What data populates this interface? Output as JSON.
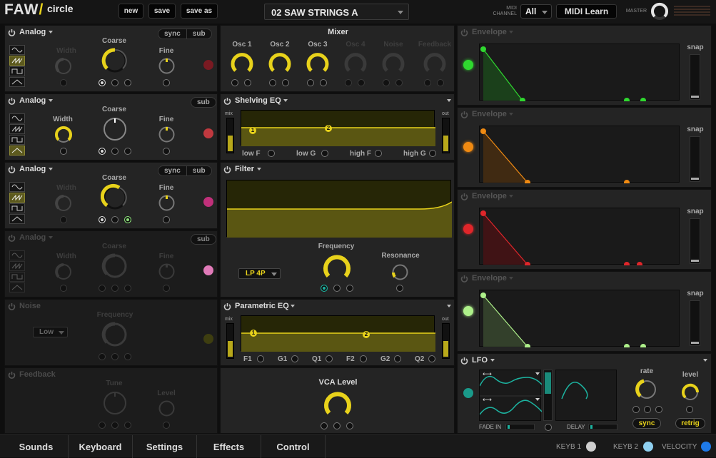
{
  "header": {
    "logo": "FAW",
    "logo_sub": "circle",
    "new_label": "new",
    "save_label": "save",
    "saveas_label": "save as",
    "preset_name": "02 SAW STRINGS A",
    "midi_channel_label_1": "MIDI",
    "midi_channel_label_2": "CHANNEL",
    "midi_channel_value": "All",
    "midi_learn_label": "MIDI Learn",
    "master_label": "MASTER"
  },
  "oscillators": [
    {
      "title": "Analog",
      "buttons": [
        "sync",
        "sub"
      ],
      "width_label": "Width",
      "coarse_label": "Coarse",
      "fine_label": "Fine",
      "led_color": "#7a1a22",
      "active": true
    },
    {
      "title": "Analog",
      "buttons": [
        "sub"
      ],
      "width_label": "Width",
      "coarse_label": "Coarse",
      "fine_label": "Fine",
      "led_color": "#c0393f",
      "active": true
    },
    {
      "title": "Analog",
      "buttons": [
        "sync",
        "sub"
      ],
      "width_label": "Width",
      "coarse_label": "Coarse",
      "fine_label": "Fine",
      "led_color": "#c0307a",
      "active": true
    },
    {
      "title": "Analog",
      "buttons": [
        "sub"
      ],
      "width_label": "Width",
      "coarse_label": "Coarse",
      "fine_label": "Fine",
      "led_color": "#e07ab8",
      "active": false
    }
  ],
  "noise": {
    "title": "Noise",
    "frequency_label": "Frequency",
    "type_value": "Low",
    "led_color": "#3e3e10"
  },
  "feedback": {
    "title": "Feedback",
    "tune_label": "Tune",
    "level_label": "Level"
  },
  "mixer": {
    "title": "Mixer",
    "channels": [
      "Osc 1",
      "Osc 2",
      "Osc 3",
      "Osc 4",
      "Noise",
      "Feedback"
    ]
  },
  "shelving_eq": {
    "title": "Shelving EQ",
    "mix_label": "mix",
    "out_label": "out",
    "params": [
      "low F",
      "low G",
      "high F",
      "high G"
    ],
    "nodes": [
      "1",
      "2"
    ]
  },
  "filter": {
    "title": "Filter",
    "type_value": "LP 4P",
    "frequency_label": "Frequency",
    "resonance_label": "Resonance"
  },
  "parametric_eq": {
    "title": "Parametric EQ",
    "mix_label": "mix",
    "out_label": "out",
    "params": [
      "F1",
      "G1",
      "Q1",
      "F2",
      "G2",
      "Q2"
    ],
    "nodes": [
      "1",
      "2"
    ]
  },
  "vca": {
    "title": "VCA Level"
  },
  "envelopes": [
    {
      "title": "Envelope",
      "snap_label": "snap",
      "color": "#2fd82f"
    },
    {
      "title": "Envelope",
      "snap_label": "snap",
      "color": "#f08a12"
    },
    {
      "title": "Envelope",
      "snap_label": "snap",
      "color": "#e0262a"
    },
    {
      "title": "Envelope",
      "snap_label": "snap",
      "color": "#aef08a"
    }
  ],
  "lfo": {
    "title": "LFO",
    "rate_label": "rate",
    "level_label": "level",
    "sync_label": "sync",
    "retrig_label": "retrig",
    "fade_in_label": "FADE IN",
    "delay_label": "DELAY",
    "led_color": "#1a9a8a"
  },
  "bottom": {
    "tabs": [
      "Sounds",
      "Keyboard",
      "Settings",
      "Effects",
      "Control"
    ],
    "keyb1_label": "KEYB 1",
    "keyb2_label": "KEYB 2",
    "velocity_label": "VELOCITY"
  },
  "colors": {
    "accent": "#e8d21b",
    "teal": "#1cb3a0"
  }
}
